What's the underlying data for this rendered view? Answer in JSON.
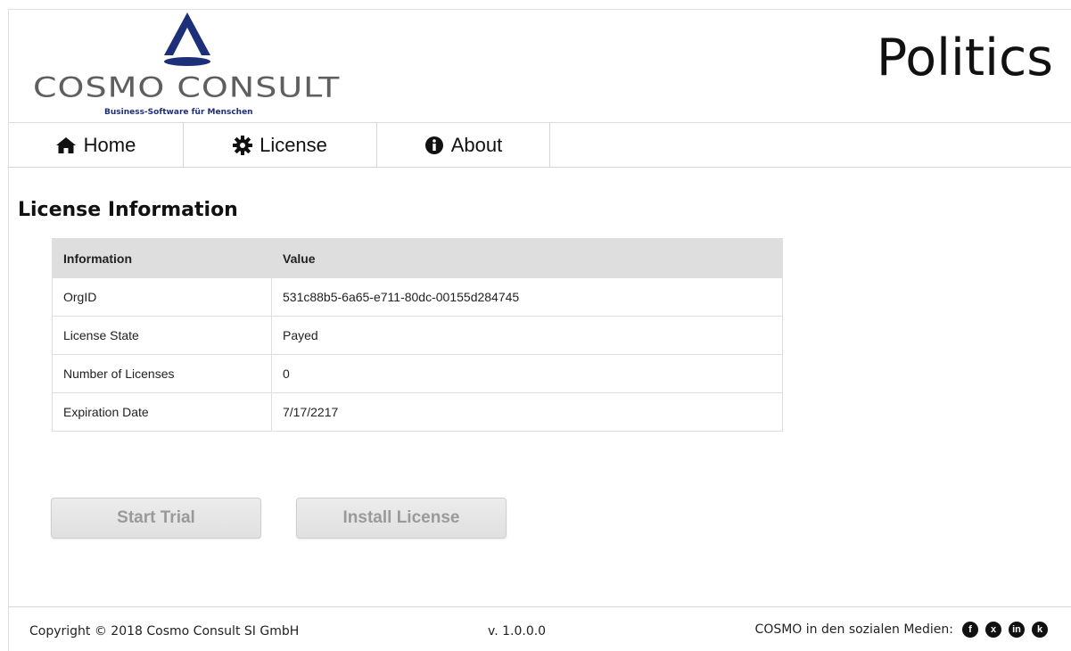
{
  "header": {
    "logo_text": "COSMO CONSULT",
    "logo_tagline": "Business-Software für Menschen",
    "app_title": "Politics",
    "logo_color": "#1e2f7a"
  },
  "nav": {
    "items": [
      {
        "label": "Home",
        "icon": "home-icon"
      },
      {
        "label": "License",
        "icon": "gear-icon"
      },
      {
        "label": "About",
        "icon": "info-icon"
      }
    ]
  },
  "content": {
    "title": "License Information",
    "table": {
      "headers": [
        "Information",
        "Value"
      ],
      "rows": [
        [
          "OrgID",
          "531c88b5-6a65-e711-80dc-00155d284745"
        ],
        [
          "License State",
          "Payed"
        ],
        [
          "Number of Licenses",
          "0"
        ],
        [
          "Expiration Date",
          "7/17/2217"
        ]
      ]
    },
    "buttons": {
      "start_trial": "Start Trial",
      "install_license": "Install License"
    }
  },
  "footer": {
    "copyright": "Copyright © 2018 Cosmo Consult SI GmbH",
    "version": "v. 1.0.0.0",
    "social_label": "COSMO in den sozialen Medien:",
    "social_icons": [
      {
        "icon": "facebook-icon",
        "glyph": "f"
      },
      {
        "icon": "xing-icon",
        "glyph": "x"
      },
      {
        "icon": "linkedin-icon",
        "glyph": "in"
      },
      {
        "icon": "kununu-icon",
        "glyph": "k"
      }
    ]
  }
}
